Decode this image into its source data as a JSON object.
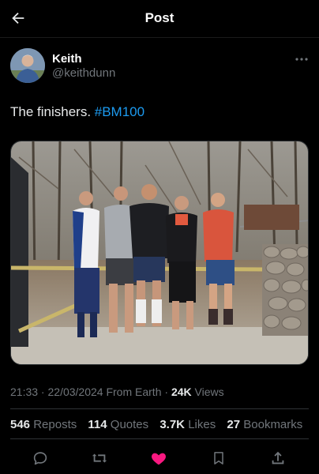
{
  "header": {
    "title": "Post"
  },
  "author": {
    "name": "Keith",
    "handle": "@keithdunn"
  },
  "tweet": {
    "text": "The finishers. ",
    "hashtag": "#BM100"
  },
  "meta": {
    "time": "21:33",
    "date": "22/03/2024",
    "source": "From Earth",
    "views_count": "24K",
    "views_label": "Views"
  },
  "stats": [
    {
      "count": "546",
      "label": "Reposts"
    },
    {
      "count": "114",
      "label": "Quotes"
    },
    {
      "count": "3.7K",
      "label": "Likes"
    },
    {
      "count": "27",
      "label": "Bookmarks"
    }
  ],
  "actions": [
    "reply-icon",
    "repost-icon",
    "like-icon",
    "bookmark-icon",
    "share-icon"
  ],
  "colors": {
    "accent": "#1d9bf0",
    "like": "#f91880",
    "muted": "#71767b",
    "background": "#000000"
  }
}
